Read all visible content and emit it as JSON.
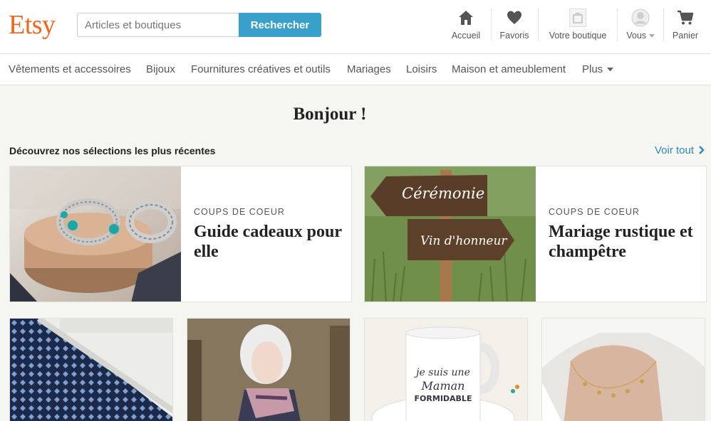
{
  "brand": {
    "logo": "Etsy",
    "accent": "#f1641e",
    "button_color": "#39a0cb"
  },
  "search": {
    "placeholder": "Articles et boutiques",
    "button_label": "Rechercher"
  },
  "nav": {
    "home": {
      "label": "Accueil",
      "icon": "house-icon"
    },
    "favorites": {
      "label": "Favoris",
      "icon": "heart-icon"
    },
    "shop": {
      "label": "Votre boutique",
      "icon": "shop-bag-icon"
    },
    "you": {
      "label": "Vous",
      "icon": "avatar"
    },
    "cart": {
      "label": "Panier",
      "icon": "cart-icon"
    }
  },
  "categories": [
    "Vêtements et accessoires",
    "Bijoux",
    "Fournitures créatives et outils",
    "Mariages",
    "Loisirs",
    "Maison et ameublement",
    "Plus"
  ],
  "main": {
    "greeting": "Bonjour !",
    "section_title": "Découvrez nos sélections les plus récentes",
    "see_all": "Voir tout"
  },
  "features": [
    {
      "kicker": "COUPS DE COEUR",
      "title": "Guide cadeaux pour elle"
    },
    {
      "kicker": "COUPS DE COEUR",
      "title": "Mariage rustique et champêtre",
      "sign_top": "Cérémonie",
      "sign_bottom": "Vin d'honneur"
    }
  ],
  "tiles": [
    {
      "subject": "patterned doormat"
    },
    {
      "subject": "woman with scarf"
    },
    {
      "subject": "mug",
      "mug_line1": "je suis une",
      "mug_line2": "Maman",
      "mug_line3": "FORMIDABLE"
    },
    {
      "subject": "gold necklace"
    }
  ]
}
